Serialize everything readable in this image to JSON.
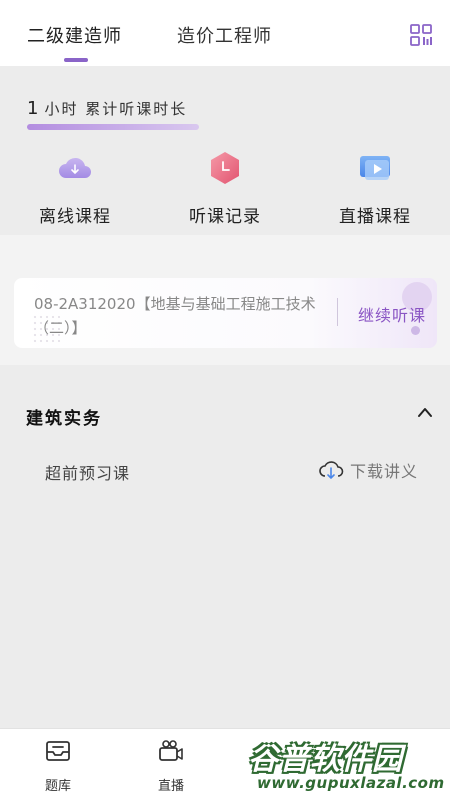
{
  "header": {
    "tabs": [
      {
        "label": "二级建造师"
      },
      {
        "label": "造价工程师"
      }
    ],
    "qr_icon": "qr-code-icon"
  },
  "study": {
    "hours_value": "1",
    "hours_label": "小时  累计听课时长"
  },
  "quick_actions": [
    {
      "label": "离线课程",
      "icon": "cloud-download-icon"
    },
    {
      "label": "听课记录",
      "icon": "clock-hexagon-icon"
    },
    {
      "label": "直播课程",
      "icon": "live-video-icon"
    }
  ],
  "resume_card": {
    "title": "08-2A312020【地基与基础工程施工技术（二）】",
    "cta": "继续听课"
  },
  "section": {
    "title": "建筑实务",
    "lesson": "超前预习课",
    "download_label": "下载讲义"
  },
  "bottom_nav": [
    {
      "label": "题库",
      "icon": "mail-tray-icon"
    },
    {
      "label": "直播",
      "icon": "video-camera-icon"
    }
  ],
  "watermark": {
    "text": "谷普软件园",
    "url": "www.gupuxlazal.com"
  },
  "colors": {
    "accent": "#8a64c8",
    "background": "#ececec",
    "watermark_green": "#2f6a32"
  }
}
